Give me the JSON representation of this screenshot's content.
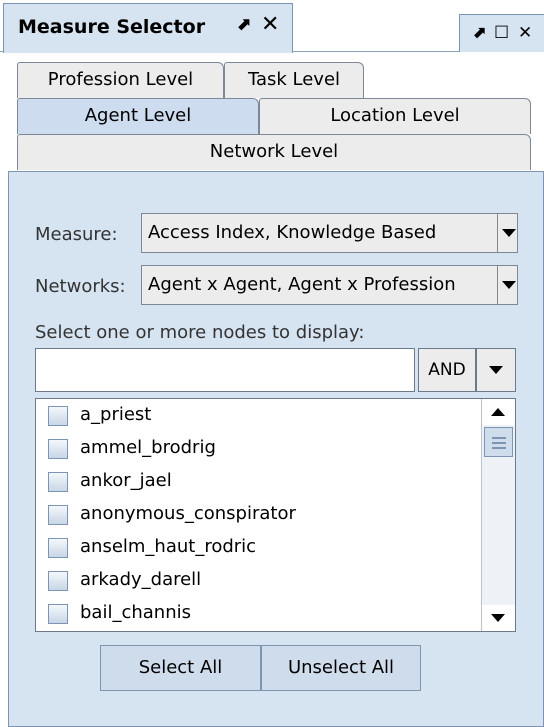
{
  "window": {
    "title": "Measure Selector",
    "pin_icon": "pin-icon",
    "close_icon": "close-icon",
    "controls": [
      "pin-icon",
      "maximize-icon",
      "close-icon"
    ]
  },
  "tabs": {
    "row1": [
      "Profession Level",
      "Task Level"
    ],
    "row2": [
      "Agent Level",
      "Location Level"
    ],
    "row3": [
      "Network Level"
    ],
    "selected": "Agent Level"
  },
  "form": {
    "measure_label": "Measure:",
    "measure_value": "Access Index, Knowledge Based",
    "networks_label": "Networks:",
    "networks_value": "Agent x Agent, Agent x Profession",
    "nodes_prompt": "Select one or more nodes to display:",
    "filter_value": "",
    "filter_mode": "AND"
  },
  "nodes": [
    "a_priest",
    "ammel_brodrig",
    "ankor_jael",
    "anonymous_conspirator",
    "anselm_haut_rodric",
    "arkady_darell",
    "bail_channis"
  ],
  "buttons": {
    "select_all": "Select All",
    "unselect_all": "Unselect All"
  },
  "colors": {
    "panel_bg": "#d6e3f1",
    "selected_tab": "#cddcee",
    "border": "#7d95b3"
  }
}
